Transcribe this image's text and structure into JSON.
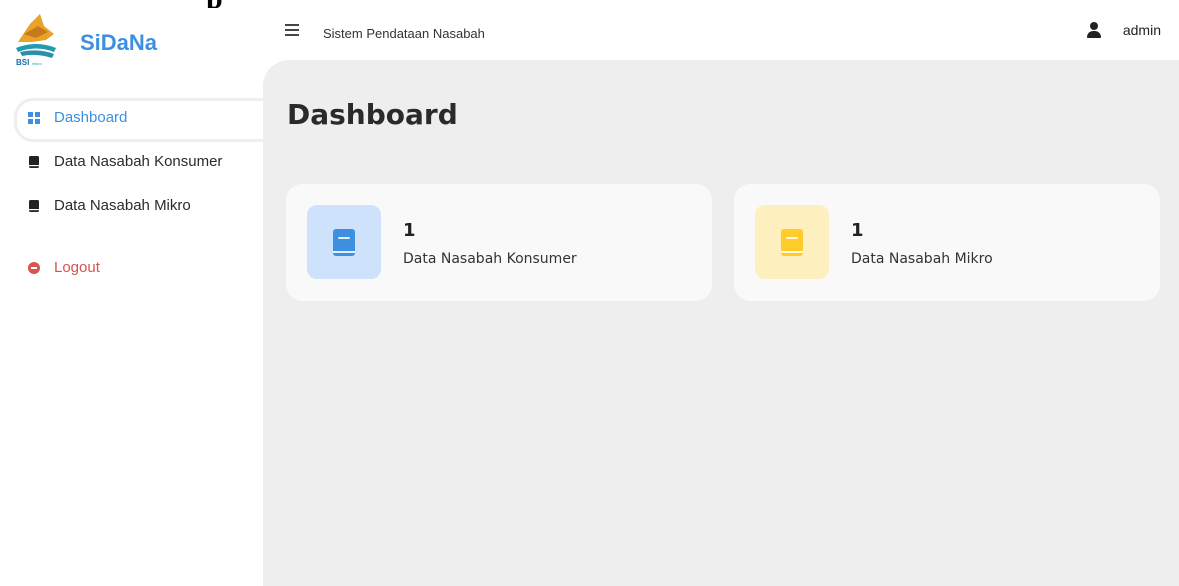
{
  "app": {
    "name": "SiDaNa",
    "title": "Sistem Pendataan Nasabah",
    "brand_color": "#3d8fe0"
  },
  "sidebar": {
    "items": [
      {
        "label": "Dashboard",
        "icon": "grid-icon",
        "active": true
      },
      {
        "label": "Data Nasabah Konsumer",
        "icon": "book-icon",
        "active": false
      },
      {
        "label": "Data Nasabah Mikro",
        "icon": "book-icon",
        "active": false
      }
    ],
    "logout": {
      "label": "Logout",
      "icon": "minus-circle-icon",
      "color": "#d9534f"
    }
  },
  "user": {
    "name": "admin",
    "icon": "user-icon"
  },
  "main": {
    "page_title": "Dashboard",
    "cards": [
      {
        "count": "1",
        "label": "Data Nasabah Konsumer",
        "icon": "book-icon",
        "icon_color": "#3d8fe0",
        "icon_bg": "#cfe2fb"
      },
      {
        "count": "1",
        "label": "Data Nasabah Mikro",
        "icon": "book-icon",
        "icon_color": "#ffcc29",
        "icon_bg": "#fdefbe"
      }
    ]
  }
}
